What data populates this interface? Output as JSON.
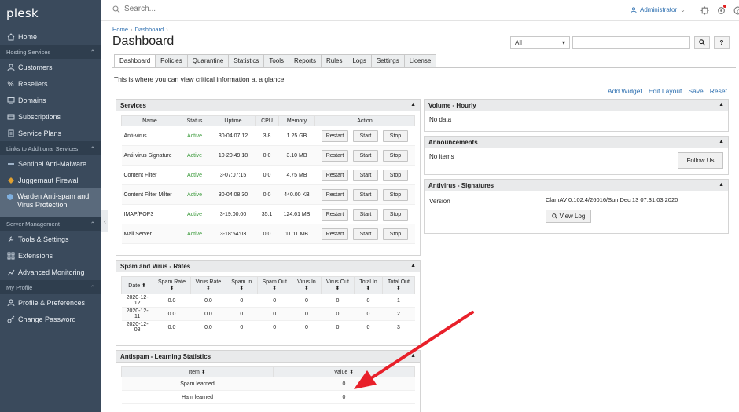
{
  "sidebar": {
    "logo": "plesk",
    "home": "Home",
    "sections": [
      {
        "title": "Hosting Services",
        "items": [
          "Customers",
          "Resellers",
          "Domains",
          "Subscriptions",
          "Service Plans"
        ]
      },
      {
        "title": "Links to Additional Services",
        "items": [
          "Sentinel Anti-Malware",
          "Juggernaut Firewall",
          "Warden Anti-spam and Virus Protection"
        ]
      },
      {
        "title": "Server Management",
        "items": [
          "Tools & Settings",
          "Extensions",
          "Advanced Monitoring"
        ]
      },
      {
        "title": "My Profile",
        "items": [
          "Profile & Preferences",
          "Change Password"
        ]
      }
    ]
  },
  "topbar": {
    "search_placeholder": "Search...",
    "user": "Administrator"
  },
  "breadcrumb": [
    "Home",
    "Dashboard"
  ],
  "page_title": "Dashboard",
  "filter": {
    "selected": "All",
    "search_button": "search-icon",
    "help_button": "?"
  },
  "tabs": [
    "Dashboard",
    "Policies",
    "Quarantine",
    "Statistics",
    "Tools",
    "Reports",
    "Rules",
    "Logs",
    "Settings",
    "License"
  ],
  "intro": "This is where you can view critical information at a glance.",
  "actions": [
    "Add Widget",
    "Edit Layout",
    "Save",
    "Reset"
  ],
  "services": {
    "title": "Services",
    "columns": [
      "Name",
      "Status",
      "Uptime",
      "CPU",
      "Memory",
      "Action"
    ],
    "buttons": [
      "Restart",
      "Start",
      "Stop"
    ],
    "rows": [
      {
        "name": "Anti-virus",
        "status": "Active",
        "uptime": "30-04:07:12",
        "cpu": "3.8",
        "memory": "1.25 GB"
      },
      {
        "name": "Anti-virus Signature",
        "status": "Active",
        "uptime": "10-20:49:18",
        "cpu": "0.0",
        "memory": "3.10 MB"
      },
      {
        "name": "Content Filter",
        "status": "Active",
        "uptime": "3-07:07:15",
        "cpu": "0.0",
        "memory": "4.75 MB"
      },
      {
        "name": "Content Filter Milter",
        "status": "Active",
        "uptime": "30-04:08:30",
        "cpu": "0.0",
        "memory": "440.00 KB"
      },
      {
        "name": "IMAP/POP3",
        "status": "Active",
        "uptime": "3-19:00:00",
        "cpu": "35.1",
        "memory": "124.61 MB"
      },
      {
        "name": "Mail Server",
        "status": "Active",
        "uptime": "3-18:54:03",
        "cpu": "0.0",
        "memory": "11.11 MB"
      }
    ]
  },
  "rates": {
    "title": "Spam and Virus - Rates",
    "columns": [
      "Date",
      "Spam Rate",
      "Virus Rate",
      "Spam In",
      "Spam Out",
      "Virus In",
      "Virus Out",
      "Total In",
      "Total Out"
    ],
    "rows": [
      [
        "2020-12-12",
        "0.0",
        "0.0",
        "0",
        "0",
        "0",
        "0",
        "0",
        "1"
      ],
      [
        "2020-12-11",
        "0.0",
        "0.0",
        "0",
        "0",
        "0",
        "0",
        "0",
        "2"
      ],
      [
        "2020-12-08",
        "0.0",
        "0.0",
        "0",
        "0",
        "0",
        "0",
        "0",
        "3"
      ]
    ]
  },
  "learning": {
    "title": "Antispam - Learning Statistics",
    "columns": [
      "Item",
      "Value"
    ],
    "rows": [
      [
        "Spam learned",
        "0"
      ],
      [
        "Ham learned",
        "0"
      ]
    ]
  },
  "volume": {
    "title": "Volume - Hourly",
    "body": "No data"
  },
  "announcements": {
    "title": "Announcements",
    "body": "No items",
    "button": "Follow Us"
  },
  "signatures": {
    "title": "Antivirus - Signatures",
    "label": "Version",
    "value": "ClamAV 0.102.4/26016/Sun Dec 13 07:31:03 2020",
    "button": "View Log"
  },
  "colors": {
    "sidebar": "#3a4a5c",
    "link": "#2d6fb0",
    "active_status": "#3a9a3a",
    "arrow": "#e8202a"
  }
}
